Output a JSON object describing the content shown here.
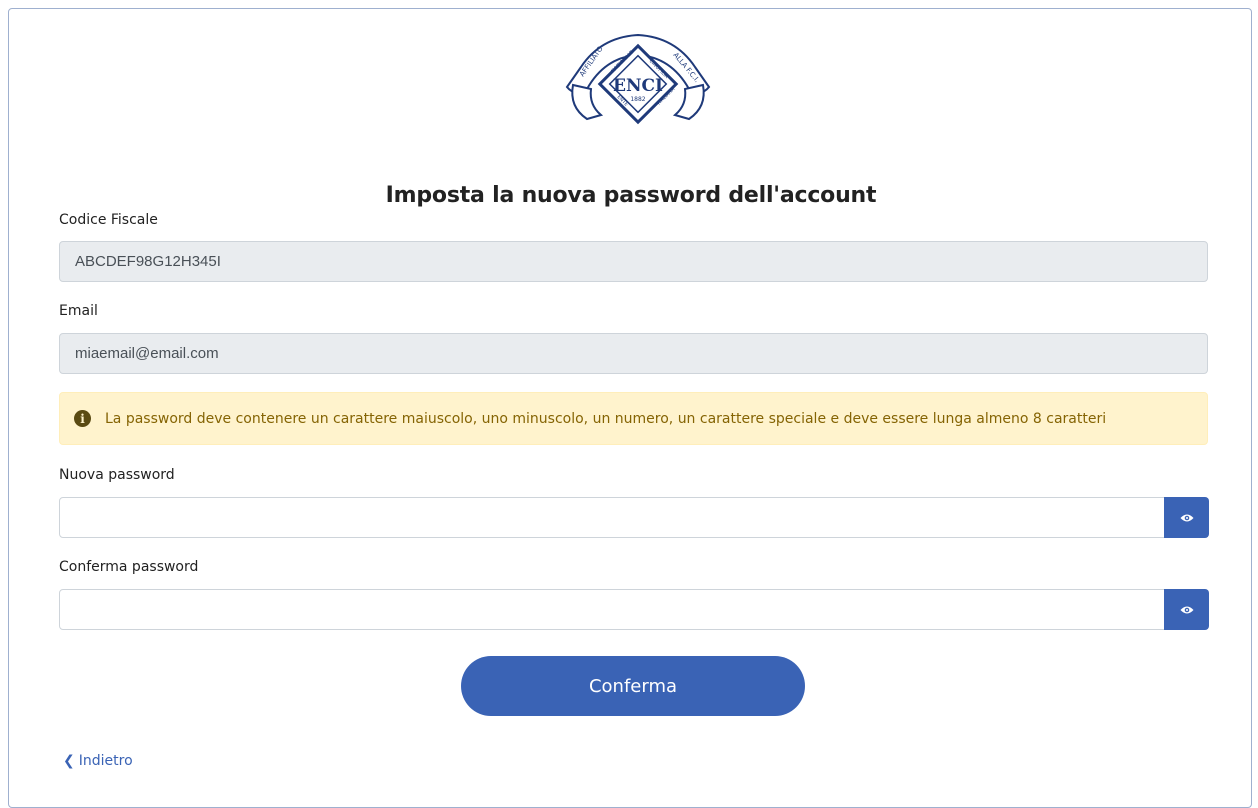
{
  "logo": {
    "icon": "enci-logo",
    "text_arc_left": "AFFILIATO",
    "text_arc_right": "ALLA F.C.I.",
    "text_ring": "ENTE NAZIONALE CINOFILIA ITALIANA",
    "monogram": "ENCI",
    "year": "1882"
  },
  "page": {
    "title": "Imposta la nuova password dell'account"
  },
  "form": {
    "codice_fiscale_label": "Codice Fiscale",
    "codice_fiscale_value": "ABCDEF98G12H345I",
    "email_label": "Email",
    "email_value": "miaemail@email.com",
    "alert_icon": "info-circle-icon",
    "alert_text": "La password deve contenere un carattere maiuscolo, uno minuscolo, un numero, un carattere speciale e deve essere lunga almeno 8 caratteri",
    "new_password_label": "Nuova password",
    "new_password_value": "",
    "confirm_password_label": "Conferma password",
    "confirm_password_value": "",
    "show_password_icon": "eye-icon",
    "submit_label": "Conferma"
  },
  "nav": {
    "back_icon": "chevron-left-icon",
    "back_label": "Indietro"
  },
  "colors": {
    "primary": "#3a63b5",
    "alert_bg": "#fff3cd",
    "alert_text": "#856404",
    "readonly_bg": "#e9ecef",
    "logo_blue": "#1f3a7a"
  }
}
